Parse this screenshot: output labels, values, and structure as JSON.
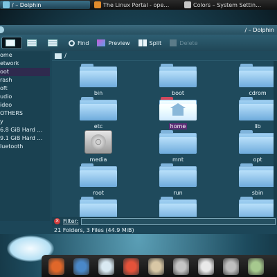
{
  "taskbar": {
    "tasks": [
      {
        "label": "/ – Dolphin",
        "active": true,
        "color": "#7cc3e0"
      },
      {
        "label": "The Linux Portal - ope…",
        "active": false,
        "color": "#e38b2c"
      },
      {
        "label": "Colors – System Settin…",
        "active": false,
        "color": "#c7c7c7"
      }
    ]
  },
  "window": {
    "title": "/ – Dolphin"
  },
  "toolbar": {
    "find": "Find",
    "preview": "Preview",
    "split": "Split",
    "delete": "Delete"
  },
  "places": [
    {
      "label": "ome",
      "selected": false
    },
    {
      "label": "etwork",
      "selected": false
    },
    {
      "label": "oot",
      "selected": true
    },
    {
      "label": "rash",
      "selected": false
    },
    {
      "label": "oft",
      "selected": false
    },
    {
      "label": "udio",
      "selected": false
    },
    {
      "label": "ideo",
      "selected": false
    },
    {
      "label": "OTHERS",
      "selected": false
    },
    {
      "label": "y",
      "selected": false
    },
    {
      "label": "6.8 GiB Hard …",
      "selected": false
    },
    {
      "label": "9.1 GiB Hard …",
      "selected": false
    },
    {
      "label": "luetooth",
      "selected": false
    }
  ],
  "breadcrumb": "/",
  "items": [
    {
      "label": "bin",
      "type": "folder"
    },
    {
      "label": "boot",
      "type": "folder"
    },
    {
      "label": "cdrom",
      "type": "folder"
    },
    {
      "label": "etc",
      "type": "folder"
    },
    {
      "label": "home",
      "type": "home",
      "selected": true
    },
    {
      "label": "lib",
      "type": "folder"
    },
    {
      "label": "media",
      "type": "drive"
    },
    {
      "label": "mnt",
      "type": "folder"
    },
    {
      "label": "opt",
      "type": "folder"
    },
    {
      "label": "root",
      "type": "folder"
    },
    {
      "label": "run",
      "type": "folder"
    },
    {
      "label": "sbin",
      "type": "folder"
    },
    {
      "label": "",
      "type": "folder"
    },
    {
      "label": "",
      "type": "folder"
    },
    {
      "label": "",
      "type": "folder"
    }
  ],
  "filter": {
    "label": "Filter:",
    "value": ""
  },
  "status": "21 Folders, 3 Files (44.9 MiB)",
  "dock": [
    {
      "icon": "firefox-icon",
      "color": "#e0672a"
    },
    {
      "icon": "thunderbird-icon",
      "color": "#4a88c8"
    },
    {
      "icon": "chat-icon",
      "color": "#d9e9f2"
    },
    {
      "icon": "package-icon",
      "color": "#e5523a"
    },
    {
      "icon": "office-icon",
      "color": "#d8c7a5"
    },
    {
      "icon": "calculator-icon",
      "color": "#c4c4c4"
    },
    {
      "icon": "notes-icon",
      "color": "#e9e9e9"
    },
    {
      "icon": "search-icon",
      "color": "#bfbfbf"
    },
    {
      "icon": "files-icon",
      "color": "#a6c98e"
    }
  ]
}
